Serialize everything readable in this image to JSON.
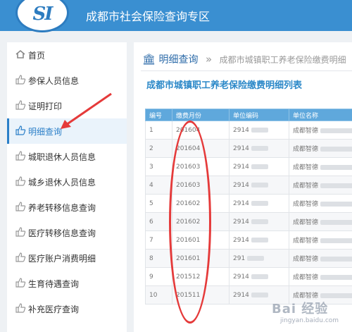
{
  "header": {
    "logo_text": "SI",
    "title": "成都市社会保险查询专区"
  },
  "sidebar": {
    "items": [
      {
        "label": "首页",
        "icon": "home-icon"
      },
      {
        "label": "参保人员信息",
        "icon": "thumbs-up-icon"
      },
      {
        "label": "证明打印",
        "icon": "thumbs-up-icon"
      },
      {
        "label": "明细查询",
        "icon": "thumbs-up-icon",
        "active": true
      },
      {
        "label": "城职退休人员信息",
        "icon": "thumbs-up-icon"
      },
      {
        "label": "城乡退休人员信息",
        "icon": "thumbs-up-icon"
      },
      {
        "label": "养老转移信息查询",
        "icon": "thumbs-up-icon"
      },
      {
        "label": "医疗转移信息查询",
        "icon": "thumbs-up-icon"
      },
      {
        "label": "医疗账户消费明细",
        "icon": "thumbs-up-icon"
      },
      {
        "label": "生育待遇查询",
        "icon": "thumbs-up-icon"
      },
      {
        "label": "补充医疗查询",
        "icon": "thumbs-up-icon"
      }
    ]
  },
  "breadcrumb": {
    "home_icon": "bank-icon",
    "current": "明细查询",
    "separator": "»",
    "sub": "成都市城镇职工养老保险缴费明细"
  },
  "main": {
    "title": "成都市城镇职工养老保险缴费明细列表"
  },
  "table": {
    "headers": [
      "编号",
      "缴费月份",
      "单位编码",
      "单位名称"
    ],
    "rows": [
      {
        "no": "1",
        "month": "201604",
        "code": "2914",
        "name": "成都智德"
      },
      {
        "no": "2",
        "month": "201604",
        "code": "2914",
        "name": "成都智德"
      },
      {
        "no": "3",
        "month": "201603",
        "code": "2914",
        "name": "成都智德"
      },
      {
        "no": "4",
        "month": "201603",
        "code": "2914",
        "name": "成都智德"
      },
      {
        "no": "5",
        "month": "201602",
        "code": "2914",
        "name": "成都智德"
      },
      {
        "no": "6",
        "month": "201602",
        "code": "2914",
        "name": "成都智德"
      },
      {
        "no": "7",
        "month": "201601",
        "code": "2914",
        "name": "成都智德"
      },
      {
        "no": "8",
        "month": "201601",
        "code": "291",
        "name": "成都智德"
      },
      {
        "no": "9",
        "month": "201512",
        "code": "2914",
        "name": "成都智德"
      },
      {
        "no": "10",
        "month": "201511",
        "code": "2914",
        "name": "成都智德"
      }
    ]
  },
  "annotations": {
    "color": "#e53a3a"
  },
  "watermark": {
    "main": "Bai 经验",
    "sub": "jingyan.baidu.com"
  },
  "colors": {
    "header": "#3a8fd1",
    "accent": "#2b88c8",
    "table_header": "#5fa8dc"
  }
}
